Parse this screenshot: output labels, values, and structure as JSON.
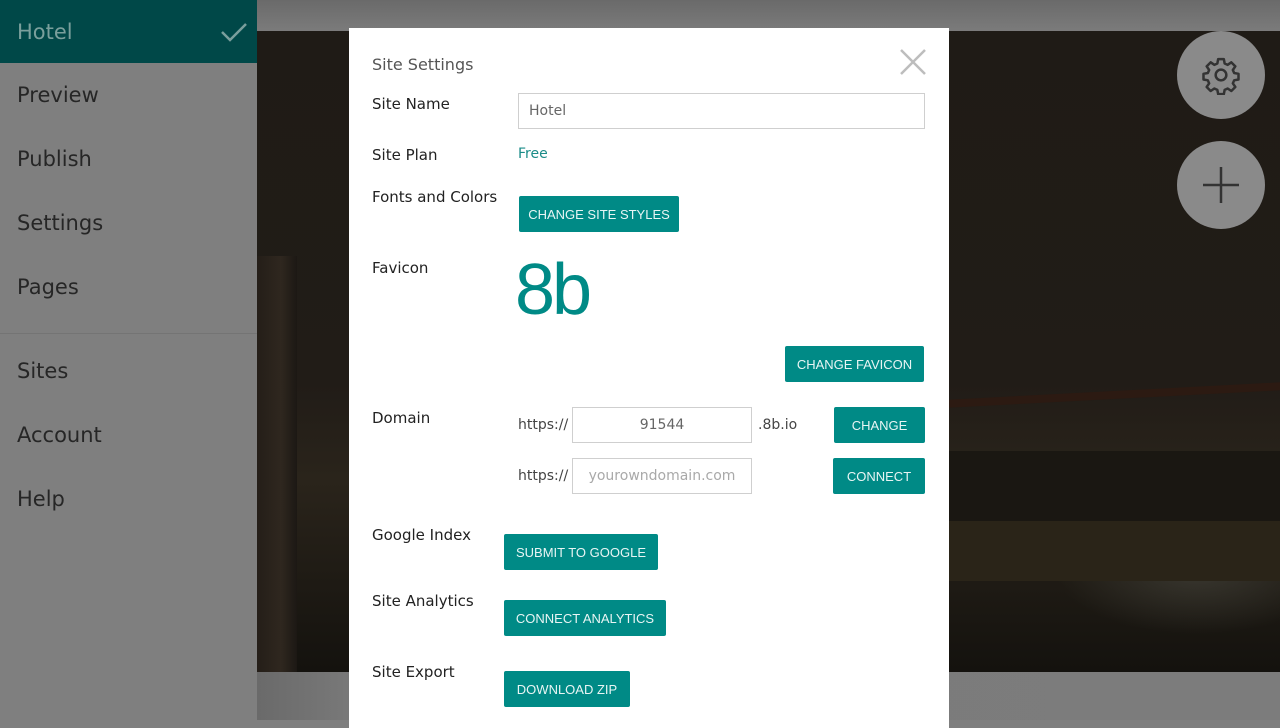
{
  "sidebar": {
    "site_title": "Hotel",
    "top_items": [
      {
        "label": "Preview"
      },
      {
        "label": "Publish"
      },
      {
        "label": "Settings"
      },
      {
        "label": "Pages"
      }
    ],
    "bottom_items": [
      {
        "label": "Sites"
      },
      {
        "label": "Account"
      },
      {
        "label": "Help"
      }
    ]
  },
  "modal": {
    "title": "Site Settings",
    "site_name": {
      "label": "Site Name",
      "value": "Hotel"
    },
    "site_plan": {
      "label": "Site Plan",
      "value": "Free"
    },
    "fonts_colors": {
      "label": "Fonts and Colors",
      "button": "CHANGE SITE STYLES"
    },
    "favicon": {
      "label": "Favicon",
      "glyph": "8b",
      "button": "CHANGE FAVICON"
    },
    "domain": {
      "label": "Domain",
      "subdomain_prefix": "https://",
      "subdomain_value": "91544",
      "subdomain_suffix": ".8b.io",
      "change_button": "CHANGE",
      "custom_prefix": "https://",
      "custom_placeholder": "yourowndomain.com",
      "connect_button": "CONNECT"
    },
    "google_index": {
      "label": "Google Index",
      "button": "SUBMIT TO GOOGLE"
    },
    "analytics": {
      "label": "Site Analytics",
      "button": "CONNECT ANALYTICS"
    },
    "export": {
      "label": "Site Export",
      "button": "DOWNLOAD ZIP"
    }
  },
  "colors": {
    "accent": "#008a86",
    "sidebar_header": "#004848"
  }
}
